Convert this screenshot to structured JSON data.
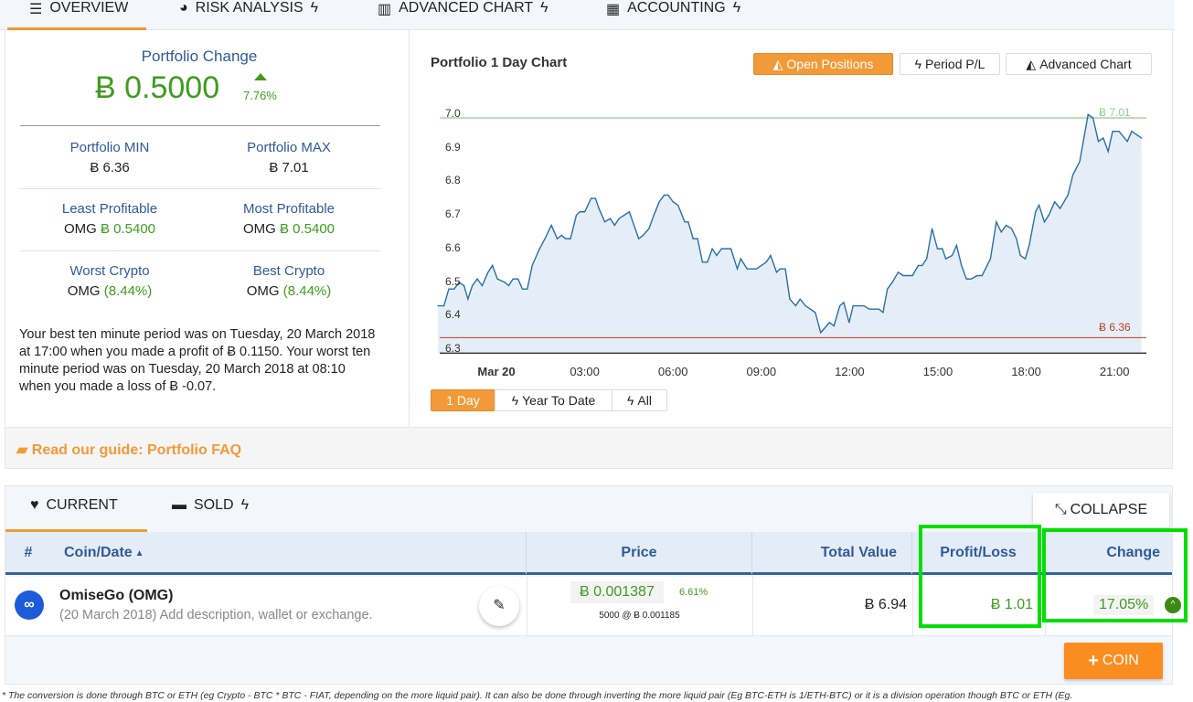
{
  "tabs": [
    {
      "label": "OVERVIEW",
      "icon": "tree-icon",
      "active": true
    },
    {
      "label": "RISK ANALYSIS",
      "icon": "pie-chart-icon",
      "bolt": true
    },
    {
      "label": "ADVANCED CHART",
      "icon": "bar-chart-icon",
      "bolt": true
    },
    {
      "label": "ACCOUNTING",
      "icon": "calculator-icon",
      "bolt": true
    }
  ],
  "summary": {
    "change_title": "Portfolio Change",
    "change_value": "Ƀ 0.5000",
    "change_pct": "7.76%",
    "min_label": "Portfolio MIN",
    "min_value": "Ƀ 6.36",
    "max_label": "Portfolio MAX",
    "max_value": "Ƀ 7.01",
    "least_label": "Least Profitable",
    "least_coin": "OMG",
    "least_value": "Ƀ 0.5400",
    "most_label": "Most Profitable",
    "most_coin": "OMG",
    "most_value": "Ƀ 0.5400",
    "worst_label": "Worst Crypto",
    "worst_coin": "OMG",
    "worst_value": "(8.44%)",
    "best_label": "Best Crypto",
    "best_coin": "OMG",
    "best_value": "(8.44%)",
    "note": "Your best ten minute period was on Tuesday, 20 March 2018 at 17:00 when you made a profit of Ƀ 0.1150. Your worst ten minute period was on Tuesday, 20 March 2018 at 08:10 when you made a loss of Ƀ -0.07."
  },
  "chart_buttons": [
    {
      "label": "Open Positions",
      "active": true
    },
    {
      "label": "Period P/L"
    },
    {
      "label": "Advanced Chart"
    }
  ],
  "range_buttons": [
    {
      "label": "1 Day",
      "active": true
    },
    {
      "label": "Year To Date"
    },
    {
      "label": "All"
    }
  ],
  "guide": "Read our guide: Portfolio FAQ",
  "chart_data": {
    "type": "area",
    "title": "Portfolio 1 Day Chart",
    "ylim": [
      6.3,
      7.0
    ],
    "yticks": [
      "7.0",
      "6.9",
      "6.8",
      "6.7",
      "6.6",
      "6.5",
      "6.4",
      "6.3"
    ],
    "xticks": [
      "Mar 20",
      "03:00",
      "06:00",
      "09:00",
      "12:00",
      "15:00",
      "18:00",
      "21:00"
    ],
    "max_line": {
      "label": "Ƀ 7.01",
      "value": 7.0,
      "color": "#8fcf8f"
    },
    "min_line": {
      "label": "Ƀ 6.36",
      "value": 6.345,
      "color": "#c0392b"
    },
    "line_color": "#2a6fa8",
    "fill_color": "#e5eef6",
    "points": [
      [
        "Mar 19 22:01",
        6.44
      ],
      [
        "Mar 19 22:13",
        6.44
      ],
      [
        "Mar 19 22:23",
        6.49
      ],
      [
        "Mar 19 22:34",
        6.49
      ],
      [
        "Mar 19 22:44",
        6.51
      ],
      [
        "Mar 19 22:54",
        6.5
      ],
      [
        "Mar 19 23:02",
        6.46
      ],
      [
        "Mar 19 23:11",
        6.5
      ],
      [
        "Mar 19 23:21",
        6.52
      ],
      [
        "Mar 19 23:31",
        6.5
      ],
      [
        "Mar 19 23:43",
        6.54
      ],
      [
        "Mar 19 23:52",
        6.56
      ],
      [
        "Mar 20 00:02",
        6.52
      ],
      [
        "Mar 20 00:17",
        6.51
      ],
      [
        "Mar 20 00:25",
        6.5
      ],
      [
        "Mar 20 00:34",
        6.52
      ],
      [
        "Mar 20 00:44",
        6.52
      ],
      [
        "Mar 20 00:53",
        6.49
      ],
      [
        "Mar 20 01:03",
        6.49
      ],
      [
        "Mar 20 01:13",
        6.56
      ],
      [
        "Mar 20 01:28",
        6.61
      ],
      [
        "Mar 20 01:39",
        6.64
      ],
      [
        "Mar 20 01:52",
        6.68
      ],
      [
        "Mar 20 02:04",
        6.64
      ],
      [
        "Mar 20 02:13",
        6.65
      ],
      [
        "Mar 20 02:21",
        6.64
      ],
      [
        "Mar 20 02:31",
        6.64
      ],
      [
        "Mar 20 02:43",
        6.71
      ],
      [
        "Mar 20 02:50",
        6.72
      ],
      [
        "Mar 20 03:00",
        6.72
      ],
      [
        "Mar 20 03:13",
        6.76
      ],
      [
        "Mar 20 03:22",
        6.76
      ],
      [
        "Mar 20 03:29",
        6.73
      ],
      [
        "Mar 20 03:41",
        6.69
      ],
      [
        "Mar 20 03:52",
        6.7
      ],
      [
        "Mar 20 04:01",
        6.68
      ],
      [
        "Mar 20 04:10",
        6.7
      ],
      [
        "Mar 20 04:31",
        6.72
      ],
      [
        "Mar 20 04:50",
        6.64
      ],
      [
        "Mar 20 04:59",
        6.65
      ],
      [
        "Mar 20 05:11",
        6.67
      ],
      [
        "Mar 20 05:21",
        6.71
      ],
      [
        "Mar 20 05:32",
        6.75
      ],
      [
        "Mar 20 05:42",
        6.77
      ],
      [
        "Mar 20 05:50",
        6.77
      ],
      [
        "Mar 20 06:00",
        6.75
      ],
      [
        "Mar 20 06:10",
        6.74
      ],
      [
        "Mar 20 06:24",
        6.69
      ],
      [
        "Mar 20 06:31",
        6.69
      ],
      [
        "Mar 20 06:41",
        6.64
      ],
      [
        "Mar 20 06:50",
        6.64
      ],
      [
        "Mar 20 07:00",
        6.57
      ],
      [
        "Mar 20 07:10",
        6.57
      ],
      [
        "Mar 20 07:20",
        6.61
      ],
      [
        "Mar 20 07:29",
        6.59
      ],
      [
        "Mar 20 07:39",
        6.61
      ],
      [
        "Mar 20 07:58",
        6.61
      ],
      [
        "Mar 20 08:11",
        6.55
      ],
      [
        "Mar 20 08:18",
        6.58
      ],
      [
        "Mar 20 08:31",
        6.55
      ],
      [
        "Mar 20 08:50",
        6.55
      ],
      [
        "Mar 20 09:00",
        6.56
      ],
      [
        "Mar 20 09:10",
        6.57
      ],
      [
        "Mar 20 09:19",
        6.59
      ],
      [
        "Mar 20 09:31",
        6.54
      ],
      [
        "Mar 20 09:38",
        6.55
      ],
      [
        "Mar 20 09:49",
        6.55
      ],
      [
        "Mar 20 09:58",
        6.46
      ],
      [
        "Mar 20 10:10",
        6.44
      ],
      [
        "Mar 20 10:19",
        6.46
      ],
      [
        "Mar 20 10:30",
        6.44
      ],
      [
        "Mar 20 10:50",
        6.42
      ],
      [
        "Mar 20 11:01",
        6.36
      ],
      [
        "Mar 20 11:19",
        6.39
      ],
      [
        "Mar 20 11:28",
        6.38
      ],
      [
        "Mar 20 11:40",
        6.44
      ],
      [
        "Mar 20 11:48",
        6.45
      ],
      [
        "Mar 20 11:59",
        6.39
      ],
      [
        "Mar 20 12:07",
        6.44
      ],
      [
        "Mar 20 12:29",
        6.44
      ],
      [
        "Mar 20 12:40",
        6.43
      ],
      [
        "Mar 20 13:00",
        6.43
      ],
      [
        "Mar 20 13:08",
        6.42
      ],
      [
        "Mar 20 13:17",
        6.49
      ],
      [
        "Mar 20 13:27",
        6.51
      ],
      [
        "Mar 20 13:39",
        6.54
      ],
      [
        "Mar 20 13:49",
        6.53
      ],
      [
        "Mar 20 14:08",
        6.53
      ],
      [
        "Mar 20 14:20",
        6.56
      ],
      [
        "Mar 20 14:28",
        6.56
      ],
      [
        "Mar 20 14:37",
        6.58
      ],
      [
        "Mar 20 14:48",
        6.67
      ],
      [
        "Mar 20 14:59",
        6.61
      ],
      [
        "Mar 20 15:09",
        6.61
      ],
      [
        "Mar 20 15:16",
        6.58
      ],
      [
        "Mar 20 15:29",
        6.59
      ],
      [
        "Mar 20 15:38",
        6.62
      ],
      [
        "Mar 20 15:48",
        6.56
      ],
      [
        "Mar 20 15:58",
        6.52
      ],
      [
        "Mar 20 16:08",
        6.52
      ],
      [
        "Mar 20 16:20",
        6.53
      ],
      [
        "Mar 20 16:30",
        6.53
      ],
      [
        "Mar 20 16:47",
        6.58
      ],
      [
        "Mar 20 16:59",
        6.69
      ],
      [
        "Mar 20 17:09",
        6.66
      ],
      [
        "Mar 20 17:19",
        6.68
      ],
      [
        "Mar 20 17:30",
        6.67
      ],
      [
        "Mar 20 17:40",
        6.64
      ],
      [
        "Mar 20 17:48",
        6.59
      ],
      [
        "Mar 20 17:58",
        6.58
      ],
      [
        "Mar 20 18:06",
        6.62
      ],
      [
        "Mar 20 18:19",
        6.72
      ],
      [
        "Mar 20 18:26",
        6.74
      ],
      [
        "Mar 20 18:37",
        6.69
      ],
      [
        "Mar 20 18:46",
        6.71
      ],
      [
        "Mar 20 18:58",
        6.75
      ],
      [
        "Mar 20 19:09",
        6.73
      ],
      [
        "Mar 20 19:25",
        6.77
      ],
      [
        "Mar 20 19:35",
        6.83
      ],
      [
        "Mar 20 19:49",
        6.87
      ],
      [
        "Mar 20 20:06",
        7.01
      ],
      [
        "Mar 20 20:16",
        7.0
      ],
      [
        "Mar 20 20:27",
        6.93
      ],
      [
        "Mar 20 20:37",
        6.94
      ],
      [
        "Mar 20 20:47",
        6.9
      ],
      [
        "Mar 20 20:56",
        6.96
      ],
      [
        "Mar 20 21:09",
        6.96
      ],
      [
        "Mar 20 21:26",
        6.93
      ],
      [
        "Mar 20 21:35",
        6.96
      ],
      [
        "Mar 20 21:55",
        6.94
      ]
    ]
  },
  "positions": {
    "tabs": [
      {
        "label": "CURRENT",
        "icon": "heartbeat-icon",
        "active": true
      },
      {
        "label": "SOLD",
        "icon": "minus-icon",
        "bolt": true
      }
    ],
    "collapse": "COLLAPSE",
    "columns": [
      "#",
      "Coin/Date",
      "Price",
      "Total Value",
      "Profit/Loss",
      "Change"
    ],
    "row": {
      "name": "OmiseGo (OMG)",
      "date": "(20 March 2018)",
      "desc": "Add description, wallet or exchange.",
      "price": "Ƀ 0.001387",
      "price_pct": "6.61%",
      "holding": "5000 @ Ƀ 0.001185",
      "total": "Ƀ 6.94",
      "pl": "Ƀ 1.01",
      "change": "17.05%"
    },
    "add_coin": "COIN"
  },
  "footnote": "* The conversion is done through BTC or ETH (eg Crypto - BTC * BTC - FIAT, depending on the more liquid pair). It can also be done through inverting the more liquid pair (Eg BTC-ETH is 1/ETH-BTC) or it is a division operation though BTC or ETH (Eg."
}
